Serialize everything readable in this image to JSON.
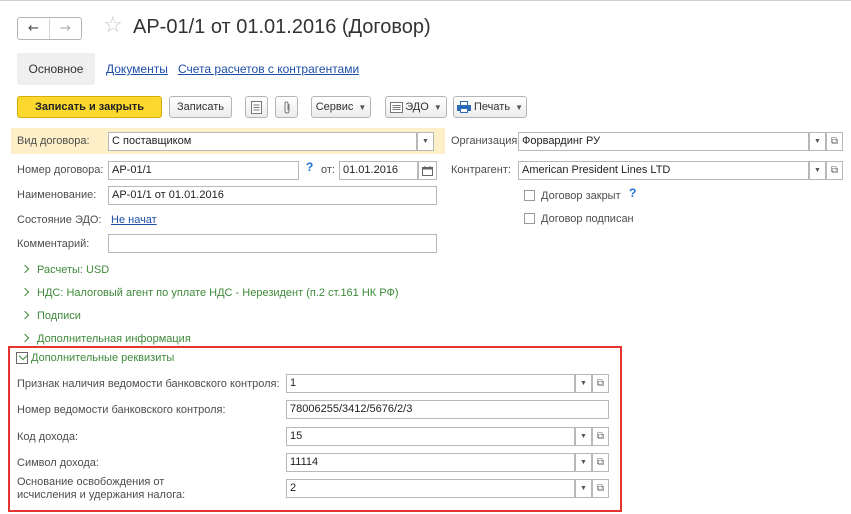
{
  "window": {
    "title": "АР-01/1 от 01.01.2016 (Договор)",
    "nav_back": "←",
    "nav_forward": "→",
    "favorite_icon": "☆"
  },
  "tabs": [
    {
      "label": "Основное",
      "active": true
    },
    {
      "label": "Документы",
      "active": false
    },
    {
      "label": "Счета расчетов с контрагентами",
      "active": false
    }
  ],
  "toolbar": {
    "save_close": "Записать и закрыть",
    "save": "Записать",
    "service": "Сервис",
    "edo": "ЭДО",
    "print": "Печать"
  },
  "form": {
    "vid_dogovora": {
      "label": "Вид договора:",
      "value": "С поставщиком"
    },
    "organizaciya": {
      "label": "Организация:",
      "value": "Форвардинг РУ"
    },
    "nomer": {
      "label": "Номер договора:",
      "value": "АР-01/1"
    },
    "q_mark": "?",
    "ot": {
      "label": "от:",
      "value": "01.01.2016"
    },
    "kontragent": {
      "label": "Контрагент:",
      "value": "American President Lines LTD"
    },
    "naimenovanie": {
      "label": "Наименование:",
      "value": "АР-01/1 от 01.01.2016"
    },
    "dogovor_zakryt": {
      "label": "Договор закрыт",
      "checked": false
    },
    "sostoyanie_edo": {
      "label": "Состояние ЭДО:",
      "value": "Не начат"
    },
    "dogovor_podpisan": {
      "label": "Договор подписан",
      "checked": false
    },
    "kommentariy": {
      "label": "Комментарий:",
      "value": ""
    }
  },
  "sections": [
    {
      "label": "Расчеты: USD",
      "expanded": false
    },
    {
      "label": "НДС: Налоговый агент по уплате НДС - Нерезидент (п.2 ст.161 НК РФ)",
      "expanded": false
    },
    {
      "label": "Подписи",
      "expanded": false
    },
    {
      "label": "Дополнительная информация",
      "expanded": false
    },
    {
      "label": "Дополнительные реквизиты",
      "expanded": true
    }
  ],
  "extra": {
    "priznak": {
      "label": "Признак наличия ведомости банковского контроля:",
      "value": "1"
    },
    "nomer_ved": {
      "label": "Номер ведомости банковского контроля:",
      "value": "78006255/3412/5676/2/3"
    },
    "kod_dohoda": {
      "label": "Код дохода:",
      "value": "15"
    },
    "simvol_dohoda": {
      "label": "Символ дохода:",
      "value": "11114"
    },
    "osnovanie_line1": "Основание освобождения от",
    "osnovanie_line2": "исчисления и удержания налога:",
    "osnovanie_value": "2"
  },
  "colors": {
    "primary_button": "#fbd82e",
    "section_text": "#3e8a3a",
    "link": "#1d4fa8",
    "highlight_box": "#e3342f",
    "field_highlight": "#fdefc7"
  },
  "icons": {
    "calendar": "calendar-icon",
    "open": "open-icon",
    "dropdown": "dropdown-arrow-icon"
  }
}
